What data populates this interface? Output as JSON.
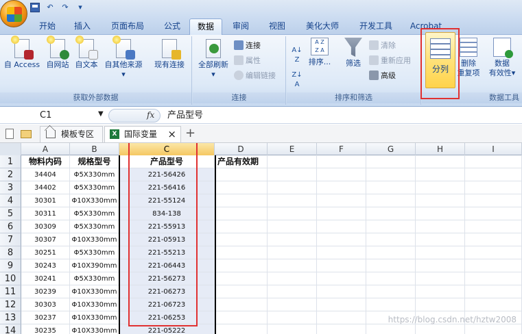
{
  "tabs": [
    "开始",
    "插入",
    "页面布局",
    "公式",
    "数据",
    "审阅",
    "视图",
    "美化大师",
    "开发工具",
    "Acrobat"
  ],
  "active_tab": "数据",
  "ribbon": {
    "external_data": {
      "label": "获取外部数据",
      "buttons": [
        "自 Access",
        "自网站",
        "自文本",
        "自其他来源",
        "现有连接"
      ]
    },
    "connections": {
      "label": "连接",
      "refresh_all": "全部刷新",
      "connect": "连接",
      "properties": "属性",
      "edit_links": "编辑链接"
    },
    "sort_filter": {
      "label": "排序和筛选",
      "sort": "排序...",
      "filter": "筛选",
      "clear": "清除",
      "reapply": "重新应用",
      "advanced": "高级"
    },
    "data_tools": {
      "label": "数据工具",
      "split": "分列",
      "remove_dup_1": "删除",
      "remove_dup_2": "重复项",
      "validation_1": "数据",
      "validation_2": "有效性"
    }
  },
  "formula_bar": {
    "name_box": "C1",
    "fx": "fx",
    "value": "产品型号"
  },
  "doc_tabs": {
    "template": "模板专区",
    "sheet": "国际变量",
    "xls_badge": "X",
    "close": "×",
    "add": "+"
  },
  "grid": {
    "columns": [
      "A",
      "B",
      "C",
      "D",
      "E",
      "F",
      "G",
      "H",
      "I"
    ],
    "selected_column": "C",
    "rows": [
      {
        "n": "1",
        "a": "物料内码",
        "b": "规格型号",
        "c": "产品型号",
        "d": "产品有效期"
      },
      {
        "n": "2",
        "a": "34404",
        "b": "Φ5X330mm",
        "c": "221-56426",
        "d": ""
      },
      {
        "n": "3",
        "a": "34402",
        "b": "Φ5X330mm",
        "c": "221-56416",
        "d": ""
      },
      {
        "n": "4",
        "a": "30301",
        "b": "Φ10X330mm",
        "c": "221-55124",
        "d": ""
      },
      {
        "n": "5",
        "a": "30311",
        "b": "Φ5X330mm",
        "c": "834-138",
        "d": ""
      },
      {
        "n": "6",
        "a": "30309",
        "b": "Φ5X330mm",
        "c": "221-55913",
        "d": ""
      },
      {
        "n": "7",
        "a": "30307",
        "b": "Φ10X330mm",
        "c": "221-05913",
        "d": ""
      },
      {
        "n": "8",
        "a": "30251",
        "b": "Φ5X330mm",
        "c": "221-55213",
        "d": ""
      },
      {
        "n": "9",
        "a": "30243",
        "b": "Φ10X390mm",
        "c": "221-06443",
        "d": ""
      },
      {
        "n": "10",
        "a": "30241",
        "b": "Φ5X330mm",
        "c": "221-56273",
        "d": ""
      },
      {
        "n": "11",
        "a": "30239",
        "b": "Φ10X330mm",
        "c": "221-06273",
        "d": ""
      },
      {
        "n": "12",
        "a": "30303",
        "b": "Φ10X330mm",
        "c": "221-06723",
        "d": ""
      },
      {
        "n": "13",
        "a": "30237",
        "b": "Φ10X330mm",
        "c": "221-06253",
        "d": ""
      },
      {
        "n": "14",
        "a": "30235",
        "b": "Φ10X330mm",
        "c": "221-05222",
        "d": ""
      }
    ]
  },
  "watermark": "https://blog.csdn.net/hztw2008",
  "colors": {
    "highlight_red": "#e03030",
    "split_button": "#ffd34a"
  }
}
